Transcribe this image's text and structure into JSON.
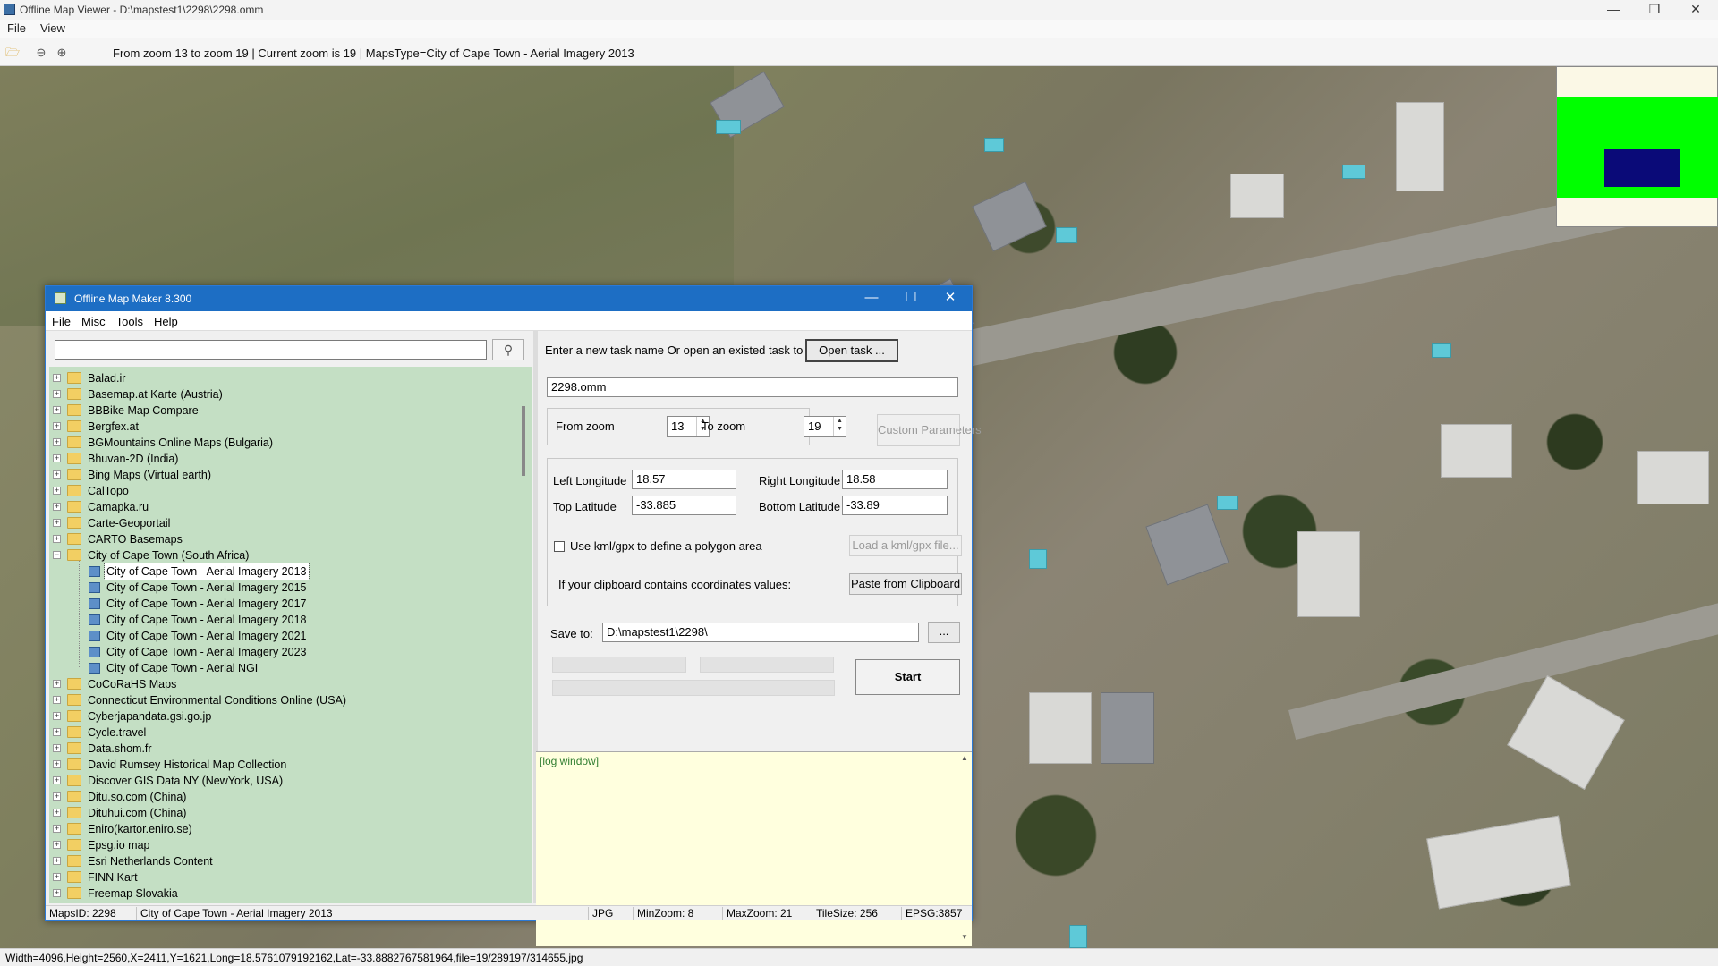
{
  "window": {
    "title": "Offline Map Viewer - D:\\mapstest1\\2298\\2298.omm",
    "minimize": "—",
    "maximize": "❐",
    "close": "✕"
  },
  "menu": [
    "File",
    "View"
  ],
  "toolbar": {
    "info": "From zoom 13 to zoom 19   |   Current zoom is 19 |   MapsType=City of Cape Town - Aerial Imagery 2013"
  },
  "statusbar": {
    "text": "Width=4096,Height=2560,X=2411,Y=1621,Long=18.5761079192162,Lat=-33.8882767581964,file=19/289197/314655.jpg"
  },
  "dialog": {
    "title": "Offline Map Maker 8.300",
    "minimize": "—",
    "maximize": "☐",
    "close": "✕",
    "menu": [
      "File",
      "Misc",
      "Tools",
      "Help"
    ],
    "search_value": "",
    "tree": [
      {
        "label": "Balad.ir"
      },
      {
        "label": "Basemap.at Karte (Austria)"
      },
      {
        "label": "BBBike Map Compare"
      },
      {
        "label": "Bergfex.at"
      },
      {
        "label": "BGMountains Online Maps (Bulgaria)"
      },
      {
        "label": "Bhuvan-2D (India)"
      },
      {
        "label": "Bing Maps (Virtual earth)"
      },
      {
        "label": "CalTopo"
      },
      {
        "label": "Camapka.ru"
      },
      {
        "label": "Carte-Geoportail"
      },
      {
        "label": "CARTO Basemaps"
      },
      {
        "label": "City of Cape Town (South Africa)"
      },
      {
        "label": "City of Cape Town - Aerial Imagery 2013"
      },
      {
        "label": "City of Cape Town - Aerial Imagery 2015"
      },
      {
        "label": "City of Cape Town - Aerial Imagery 2017"
      },
      {
        "label": "City of Cape Town - Aerial Imagery 2018"
      },
      {
        "label": "City of Cape Town - Aerial Imagery 2021"
      },
      {
        "label": "City of Cape Town - Aerial Imagery 2023"
      },
      {
        "label": "City of Cape Town - Aerial NGI"
      },
      {
        "label": "CoCoRaHS Maps"
      },
      {
        "label": "Connecticut Environmental Conditions Online (USA)"
      },
      {
        "label": "Cyberjapandata.gsi.go.jp"
      },
      {
        "label": "Cycle.travel"
      },
      {
        "label": "Data.shom.fr"
      },
      {
        "label": "David Rumsey Historical Map Collection"
      },
      {
        "label": "Discover GIS Data NY (NewYork, USA)"
      },
      {
        "label": "Ditu.so.com (China)"
      },
      {
        "label": "Dituhui.com (China)"
      },
      {
        "label": "Eniro(kartor.eniro.se)"
      },
      {
        "label": "Epsg.io map"
      },
      {
        "label": "Esri Netherlands Content"
      },
      {
        "label": "FINN Kart"
      },
      {
        "label": "Freemap Slovakia"
      }
    ],
    "task_prompt": "Enter a new task name Or open an existed task to continue:",
    "open_task": "Open task ...",
    "task_name": "2298.omm",
    "from_zoom_label": "From zoom",
    "from_zoom": "13",
    "to_zoom_label": "To zoom",
    "to_zoom": "19",
    "custom_params": "Custom Parameters",
    "left_lon_label": "Left Longitude",
    "left_lon": "18.57",
    "right_lon_label": "Right Longitude",
    "right_lon": "18.58",
    "top_lat_label": "Top Latitude",
    "top_lat": "-33.885",
    "bottom_lat_label": "Bottom Latitude",
    "bottom_lat": "-33.89",
    "kml_label": "Use kml/gpx to define a polygon area",
    "load_kml": "Load a kml/gpx file...",
    "clipboard_label": "If your clipboard contains coordinates values:",
    "paste_clipboard": "Paste from Clipboard",
    "save_to_label": "Save to:",
    "save_to": "D:\\mapstest1\\2298\\",
    "browse": "...",
    "start": "Start",
    "log": "[log window]",
    "status": {
      "mapsid": "MapsID: 2298",
      "mapname": "City of Cape Town - Aerial Imagery 2013",
      "format": "JPG",
      "minzoom": "MinZoom: 8",
      "maxzoom": "MaxZoom: 21",
      "tilesize": "TileSize: 256",
      "epsg": "EPSG:3857"
    }
  }
}
